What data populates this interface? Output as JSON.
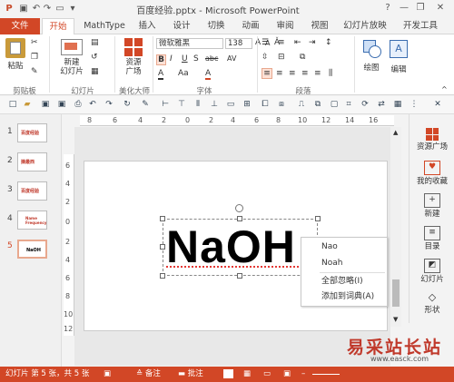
{
  "title": "百度经验.pptx - Microsoft PowerPoint",
  "window_controls": {
    "help": "?",
    "min": "—",
    "max": "❐",
    "close": "✕"
  },
  "tabs": [
    "文件",
    "开始",
    "MathType",
    "插入",
    "设计",
    "切换",
    "动画",
    "审阅",
    "视图",
    "幻灯片放映",
    "开发工具"
  ],
  "ribbon": {
    "paste": "粘贴",
    "new_slide": "新建\n幻灯片",
    "resources": "资源\n广场",
    "font_name": "微软雅黑",
    "font_size": "138",
    "drawing": "绘图",
    "editing": "编辑",
    "groups": [
      "剪贴板",
      "幻灯片",
      "美化大师",
      "字体",
      "段落"
    ],
    "font_buttons": [
      "B",
      "I",
      "U",
      "S",
      "abc",
      "AV"
    ],
    "font_row1": [
      "A",
      "A",
      "Ǎ"
    ],
    "font_row3": [
      "A",
      "Aa",
      "A"
    ]
  },
  "hruler_ticks": [
    "8",
    "6",
    "4",
    "2",
    "0",
    "2",
    "4",
    "6",
    "8",
    "10",
    "12",
    "14",
    "16"
  ],
  "vruler_ticks": [
    "6",
    "4",
    "2",
    "0",
    "2",
    "4",
    "6",
    "8",
    "10",
    "12"
  ],
  "slides": [
    {
      "num": "1",
      "text": "百度经验"
    },
    {
      "num": "2",
      "text": "摘最西"
    },
    {
      "num": "3",
      "text": "百度经验"
    },
    {
      "num": "4",
      "text": "Name\nFrequency"
    },
    {
      "num": "5",
      "text": "NaOH"
    }
  ],
  "slide_text": "NaOH",
  "context_menu": [
    "Nao",
    "Noah",
    "全部忽略(I)",
    "添加到词典(A)"
  ],
  "right_panel": [
    "资源广场",
    "我的收藏",
    "新建",
    "目录",
    "幻灯片",
    "形状"
  ],
  "status": {
    "slide_info": "幻灯片 第 5 张，共 5 张",
    "notes": "备注",
    "comments": "批注"
  },
  "watermark": {
    "line1": "易采站长站",
    "line2": "www.easck.com"
  },
  "colors": {
    "accent": "#d24726",
    "watermark": "#c0392b"
  }
}
